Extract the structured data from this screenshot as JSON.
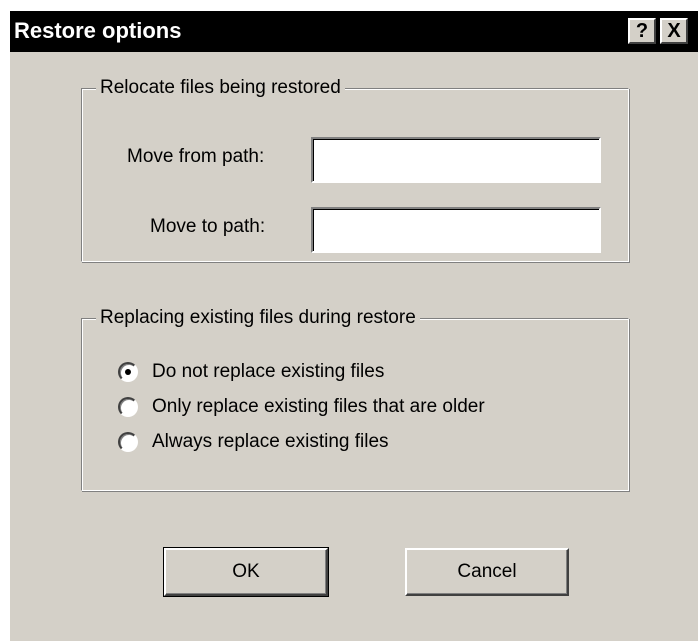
{
  "dialog": {
    "title": "Restore options",
    "help_label": "?",
    "close_label": "X"
  },
  "relocate": {
    "legend": "Relocate files being restored",
    "move_from_label": "Move from path:",
    "move_from_value": "",
    "move_to_label": "Move to path:",
    "move_to_value": ""
  },
  "replace": {
    "legend": "Replacing existing files during restore",
    "options": [
      {
        "label": "Do not replace existing files",
        "checked": true
      },
      {
        "label": "Only replace existing files that are older",
        "checked": false
      },
      {
        "label": "Always replace existing files",
        "checked": false
      }
    ]
  },
  "buttons": {
    "ok_label": "OK",
    "cancel_label": "Cancel"
  }
}
